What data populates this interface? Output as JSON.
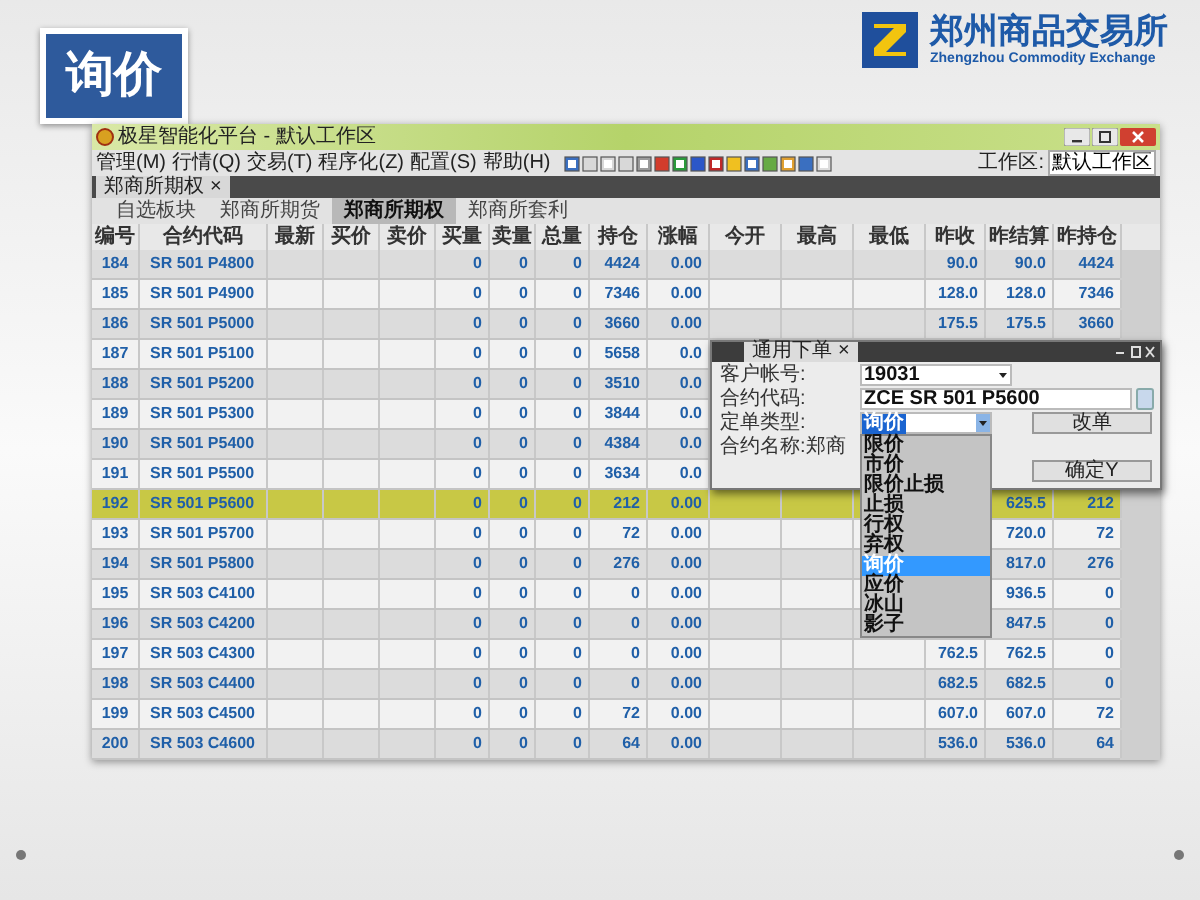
{
  "slide": {
    "title": "询价"
  },
  "logo": {
    "name": "郑州商品交易所",
    "subtitle": "Zhengzhou Commodity Exchange"
  },
  "window": {
    "title": "极星智能化平台 - 默认工作区"
  },
  "menu": [
    "管理(M)",
    "行情(Q)",
    "交易(T)",
    "程序化(Z)",
    "配置(S)",
    "帮助(H)"
  ],
  "workspace": {
    "label": "工作区:",
    "value": "默认工作区"
  },
  "document_tab": {
    "label": "郑商所期权",
    "close": "×"
  },
  "board_tabs": [
    {
      "label": "自选板块",
      "selected": false
    },
    {
      "label": "郑商所期货",
      "selected": false
    },
    {
      "label": "郑商所期权",
      "selected": true
    },
    {
      "label": "郑商所套利",
      "selected": false
    }
  ],
  "table": {
    "columns": [
      "编号",
      "合约代码",
      "最新",
      "买价",
      "卖价",
      "买量",
      "卖量",
      "总量",
      "持仓",
      "涨幅",
      "今开",
      "最高",
      "最低",
      "昨收",
      "昨结算",
      "昨持仓"
    ],
    "rows": [
      {
        "selected": false,
        "cells": [
          "184",
          "SR 501 P4800",
          null,
          null,
          null,
          "0",
          "0",
          "0",
          "4424",
          "0.00",
          null,
          null,
          null,
          "90.0",
          "90.0",
          "4424"
        ]
      },
      {
        "selected": false,
        "cells": [
          "185",
          "SR 501 P4900",
          null,
          null,
          null,
          "0",
          "0",
          "0",
          "7346",
          "0.00",
          null,
          null,
          null,
          "128.0",
          "128.0",
          "7346"
        ]
      },
      {
        "selected": false,
        "cells": [
          "186",
          "SR 501 P5000",
          null,
          null,
          null,
          "0",
          "0",
          "0",
          "3660",
          "0.00",
          null,
          null,
          null,
          "175.5",
          "175.5",
          "3660"
        ]
      },
      {
        "selected": false,
        "cells": [
          "187",
          "SR 501 P5100",
          null,
          null,
          null,
          "0",
          "0",
          "0",
          "5658",
          "0.0",
          null,
          null,
          null,
          null,
          null,
          null
        ]
      },
      {
        "selected": false,
        "cells": [
          "188",
          "SR 501 P5200",
          null,
          null,
          null,
          "0",
          "0",
          "0",
          "3510",
          "0.0",
          null,
          null,
          null,
          null,
          null,
          null
        ]
      },
      {
        "selected": false,
        "cells": [
          "189",
          "SR 501 P5300",
          null,
          null,
          null,
          "0",
          "0",
          "0",
          "3844",
          "0.0",
          null,
          null,
          null,
          null,
          null,
          null
        ]
      },
      {
        "selected": false,
        "cells": [
          "190",
          "SR 501 P5400",
          null,
          null,
          null,
          "0",
          "0",
          "0",
          "4384",
          "0.0",
          null,
          null,
          null,
          null,
          null,
          null
        ]
      },
      {
        "selected": false,
        "cells": [
          "191",
          "SR 501 P5500",
          null,
          null,
          null,
          "0",
          "0",
          "0",
          "3634",
          "0.0",
          null,
          null,
          null,
          null,
          null,
          null
        ]
      },
      {
        "selected": true,
        "cells": [
          "192",
          "SR 501 P5600",
          null,
          null,
          null,
          "0",
          "0",
          "0",
          "212",
          "0.00",
          null,
          null,
          null,
          null,
          "625.5",
          "212"
        ]
      },
      {
        "selected": false,
        "cells": [
          "193",
          "SR 501 P5700",
          null,
          null,
          null,
          "0",
          "0",
          "0",
          "72",
          "0.00",
          null,
          null,
          null,
          null,
          "720.0",
          "72"
        ]
      },
      {
        "selected": false,
        "cells": [
          "194",
          "SR 501 P5800",
          null,
          null,
          null,
          "0",
          "0",
          "0",
          "276",
          "0.00",
          null,
          null,
          null,
          null,
          "817.0",
          "276"
        ]
      },
      {
        "selected": false,
        "cells": [
          "195",
          "SR 503 C4100",
          null,
          null,
          null,
          "0",
          "0",
          "0",
          "0",
          "0.00",
          null,
          null,
          null,
          null,
          "936.5",
          "0"
        ]
      },
      {
        "selected": false,
        "cells": [
          "196",
          "SR 503 C4200",
          null,
          null,
          null,
          "0",
          "0",
          "0",
          "0",
          "0.00",
          null,
          null,
          null,
          null,
          "847.5",
          "0"
        ]
      },
      {
        "selected": false,
        "cells": [
          "197",
          "SR 503 C4300",
          null,
          null,
          null,
          "0",
          "0",
          "0",
          "0",
          "0.00",
          null,
          null,
          null,
          "762.5",
          "762.5",
          "0"
        ]
      },
      {
        "selected": false,
        "cells": [
          "198",
          "SR 503 C4400",
          null,
          null,
          null,
          "0",
          "0",
          "0",
          "0",
          "0.00",
          null,
          null,
          null,
          "682.5",
          "682.5",
          "0"
        ]
      },
      {
        "selected": false,
        "cells": [
          "199",
          "SR 503 C4500",
          null,
          null,
          null,
          "0",
          "0",
          "0",
          "72",
          "0.00",
          null,
          null,
          null,
          "607.0",
          "607.0",
          "72"
        ]
      },
      {
        "selected": false,
        "cells": [
          "200",
          "SR 503 C4600",
          null,
          null,
          null,
          "0",
          "0",
          "0",
          "64",
          "0.00",
          null,
          null,
          null,
          "536.0",
          "536.0",
          "64"
        ]
      }
    ]
  },
  "order_dialog": {
    "tab": "通用下单",
    "close": "×",
    "fields": [
      {
        "kind": "select",
        "label": "客户帐号:",
        "value": "19031"
      },
      {
        "kind": "text",
        "label": "合约代码:",
        "value": "ZCE SR 501 P5600"
      },
      {
        "kind": "select",
        "label": "定单类型:",
        "value": "询价",
        "open": true
      }
    ],
    "contract_name_label": "合约名称:郑商",
    "buttons": [
      "改单",
      "确定Y"
    ],
    "order_types": [
      {
        "label": "限价",
        "selected": false
      },
      {
        "label": "市价",
        "selected": false
      },
      {
        "label": "限价止损",
        "selected": false
      },
      {
        "label": "止损",
        "selected": false
      },
      {
        "label": "行权",
        "selected": false
      },
      {
        "label": "弃权",
        "selected": false
      },
      {
        "label": "询价",
        "selected": true
      },
      {
        "label": "应价",
        "selected": false
      },
      {
        "label": "冰山",
        "selected": false
      },
      {
        "label": "影子",
        "selected": false
      }
    ]
  }
}
